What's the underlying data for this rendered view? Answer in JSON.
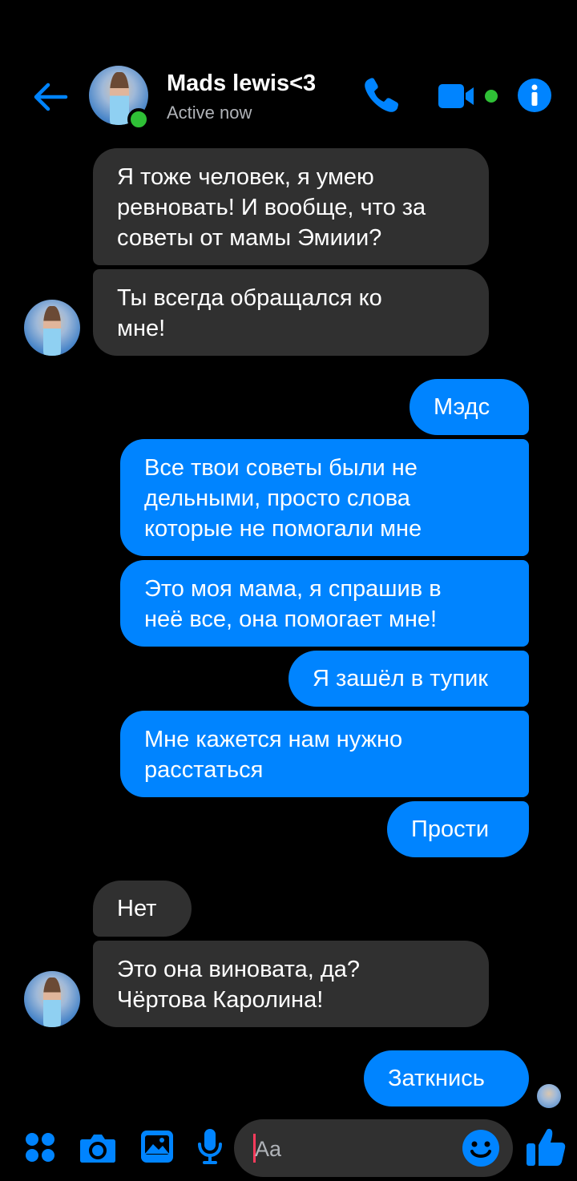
{
  "header": {
    "contact_name": "Mads lewis<3",
    "status": "Active now",
    "icons": [
      "back-arrow-icon",
      "phone-icon",
      "video-camera-icon",
      "info-icon"
    ],
    "accent_color": "#0084ff",
    "online_color": "#2fc036"
  },
  "messages": [
    {
      "from": "them",
      "text_lines": [
        "Я тоже человек, я умею",
        "ревновать! И вообще, что за",
        "советы от мамы Эмиии?"
      ]
    },
    {
      "from": "them",
      "text_lines": [
        "Ты всегда обращался ко",
        "мне!"
      ]
    },
    {
      "from": "me",
      "text_lines": [
        "Мэдс"
      ]
    },
    {
      "from": "me",
      "text_lines": [
        "Все твои советы были не",
        "дельными, просто слова",
        "которые не помогали мне"
      ]
    },
    {
      "from": "me",
      "text_lines": [
        "Это моя мама, я спрашив в",
        "неё все, она помогает мне!"
      ]
    },
    {
      "from": "me",
      "text_lines": [
        "Я зашёл в тупик"
      ]
    },
    {
      "from": "me",
      "text_lines": [
        "Мне кажется нам нужно",
        "расстаться"
      ]
    },
    {
      "from": "me",
      "text_lines": [
        "Прости"
      ]
    },
    {
      "from": "them",
      "text_lines": [
        "Нет"
      ]
    },
    {
      "from": "them",
      "text_lines": [
        "Это она виновата, да?",
        "Чёртова Каролина!"
      ]
    },
    {
      "from": "me",
      "text_lines": [
        "Заткнись"
      ]
    }
  ],
  "composer": {
    "placeholder": "Aa",
    "tools": [
      "apps-grid-icon",
      "camera-icon",
      "gallery-icon",
      "microphone-icon"
    ],
    "emoji_icon": "smile-emoji-icon",
    "like_icon": "thumbs-up-icon"
  },
  "colors": {
    "background": "#000000",
    "incoming_bubble": "#303030",
    "outgoing_bubble": "#0084ff",
    "secondary_text": "#b0b3b8"
  }
}
